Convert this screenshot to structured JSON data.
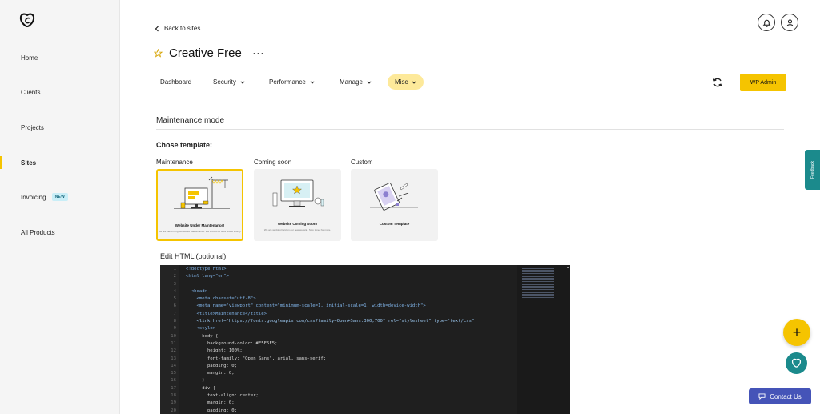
{
  "sidebar": {
    "items": [
      {
        "label": "Home"
      },
      {
        "label": "Clients"
      },
      {
        "label": "Projects"
      },
      {
        "label": "Sites"
      },
      {
        "label": "Invoicing",
        "badge": "NEW"
      },
      {
        "label": "All Products"
      }
    ],
    "active_item": "Sites"
  },
  "header": {
    "back_label": "Back to sites",
    "site_title": "Creative Free",
    "more_label": "···"
  },
  "tabs": [
    {
      "label": "Dashboard"
    },
    {
      "label": "Security"
    },
    {
      "label": "Performance"
    },
    {
      "label": "Manage"
    },
    {
      "label": "Misc"
    }
  ],
  "active_tab": "Misc",
  "wp_admin_label": "WP Admin",
  "section": {
    "title": "Maintenance mode",
    "chose_template": "Chose template:"
  },
  "templates": [
    {
      "label": "Maintenance",
      "caption": "Website Under Maintenance!",
      "sub": "We are performing scheduled maintenance. We should be back online shortly.",
      "selected": true
    },
    {
      "label": "Coming soon",
      "caption": "Website Coming Soon!",
      "sub": "We are working hard on our new website. Stay tuned for more.",
      "selected": false
    },
    {
      "label": "Custom",
      "caption": "Custom Template",
      "sub": "",
      "selected": false
    }
  ],
  "editor": {
    "label": "Edit HTML (optional)",
    "line_numbers": [
      "1",
      "2",
      "3",
      "4",
      "5",
      "6",
      "7",
      "8",
      "9",
      "10",
      "11",
      "12",
      "13",
      "14",
      "15",
      "16",
      "17",
      "18",
      "19",
      "20"
    ],
    "lines": [
      "<!doctype html>",
      "<html lang=\"en\">",
      "",
      "  <head>",
      "    <meta charset=\"utf-8\">",
      "    <meta name=\"viewport\" content=\"minimum-scale=1, initial-scale=1, width=device-width\">",
      "    <title>Maintenance</title>",
      "    <link href=\"https://fonts.googleapis.com/css?family=Open+Sans:300,700\" rel=\"stylesheet\" type=\"text/css\"",
      "    <style>",
      "      body {",
      "        background-color: #F5F5F5;",
      "        height: 100%;",
      "        font-family: \"Open Sans\", arial, sans-serif;",
      "        padding: 0;",
      "        margin: 0;",
      "      }",
      "      div {",
      "        text-align: center;",
      "        margin: 0;",
      "        padding: 0;"
    ]
  },
  "feedback_label": "Feedback",
  "contact_label": "Contact Us",
  "colors": {
    "accent": "#f5c400",
    "teal": "#1b8a8c",
    "contact": "#4554b8",
    "editor_bg": "#1f1f1f"
  }
}
